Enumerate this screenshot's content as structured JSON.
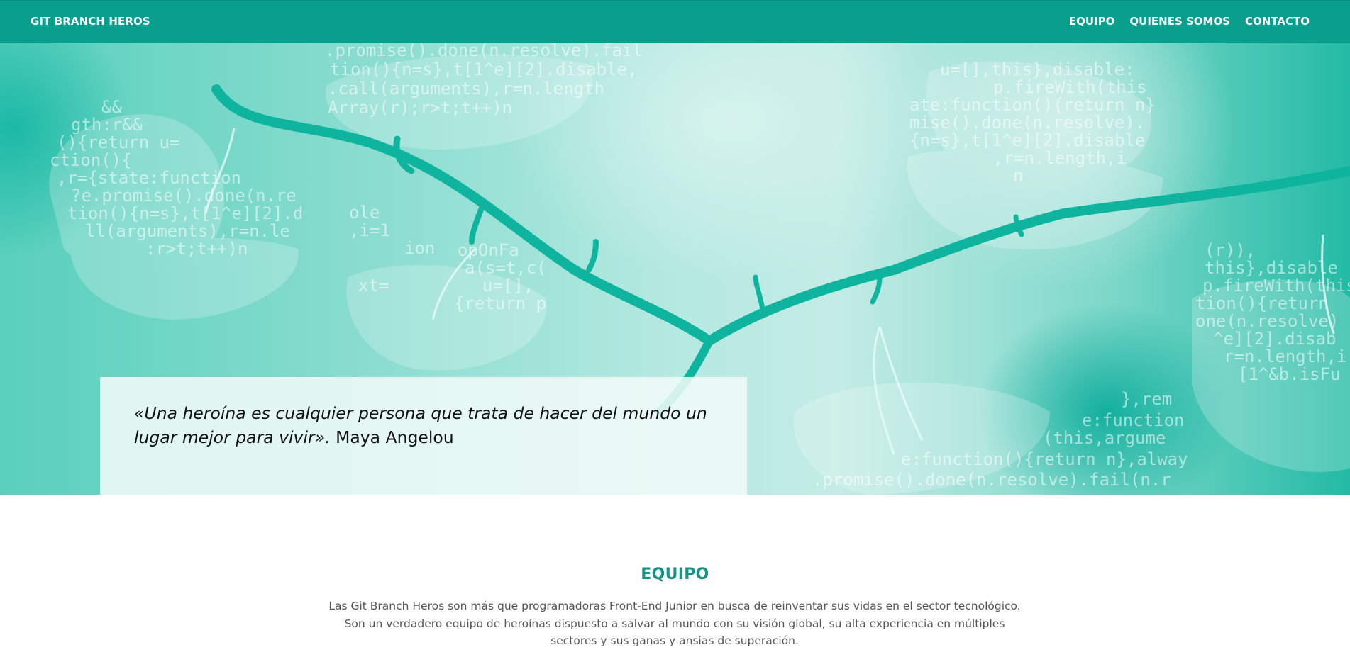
{
  "navbar": {
    "brand": "GIT BRANCH HEROS",
    "links": [
      "EQUIPO",
      "QUIENES SOMOS",
      "CONTACTO"
    ]
  },
  "hero": {
    "quote_italic": "«Una heroína es cualquier persona que trata de hacer del mundo un lugar mejor para vivir».",
    "quote_author": " Maya Angelou",
    "code_snippets": [
      ".promise().done(n.resolve).fail",
      "tion(){n=s},t[1^e][2].disable,",
      ".call(arguments),r=n.length",
      "Array(r);r>t;t++)n",
      "&&",
      "gth:r&&",
      "(){return u=",
      "ction(){",
      ",r={state:function",
      "?e.promise().done(n.re",
      "tion(){n=s},t[1^e][2].d",
      "ll(arguments),r=n.le",
      ":r>t;t++)n",
      "ole",
      ",i=1",
      "ion",
      "opOnFa",
      "a(s=t,c(",
      "u=[],",
      "xt=",
      "{return p",
      "u=[],this},disable:",
      "p.fireWith(this",
      "ate:function(){return n}",
      "mise().done(n.resolve).",
      "{n=s},t[1^e][2].disable",
      ",r=n.length,i",
      "n",
      "(r)),",
      "this},disable",
      "p.fireWith(this",
      "tion(){return",
      "one(n.resolve)",
      "^e][2].disab",
      "r=n.length,i",
      "[1^&b.isFu",
      "},rem",
      "e:function",
      "(this,argume",
      "e:function(){return n},alway",
      ".promise().done(n.resolve).fail(n.r"
    ]
  },
  "equipo": {
    "title": "EQUIPO",
    "lines": [
      "Las Git Branch Heros son más que programadoras Front-End Junior en busca de reinventar sus vidas en el sector tecnológico.",
      "Son un verdadero equipo de heroínas dispuesto a salvar al mundo con su visión global, su alta experiencia en múltiples",
      "sectores y sus ganas y ansias de superación."
    ]
  }
}
